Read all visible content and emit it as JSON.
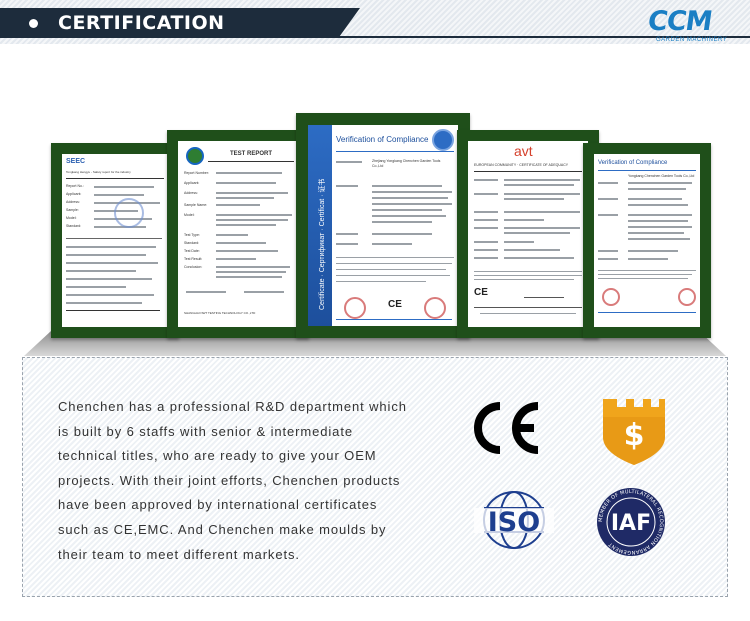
{
  "header": {
    "title": "CERTIFICATION",
    "logo_text": "CCM",
    "logo_sub": "GARDEN MACHINERY"
  },
  "certificates": [
    {
      "name": "certificate-1",
      "brand": "SEEC",
      "top": "Tongkang Hengyu - Safety report for the industry",
      "rows": [
        "Report No.:",
        "Applicant:",
        "Address:",
        "Sample:",
        "Model:",
        "Standard:"
      ]
    },
    {
      "name": "certificate-2",
      "title": "TEST REPORT",
      "rows": [
        "Report Number:",
        "Applicant:",
        "Address:",
        "Sample Name:",
        "Model:",
        "Test Type:",
        "Standard:",
        "Test Date:",
        "Test Result:",
        "Conclusion:"
      ],
      "foot": "SHANGHAI NWT TESTING TECHNOLOGY CO.,LTD"
    },
    {
      "name": "certificate-3",
      "title": "Verification of Compliance",
      "side": "Certificate · Сертификат · Certificat · 证书",
      "holder": "Zhejiang Yongkang Chenchen Garden Tools Co.,Ltd",
      "ce": "CE"
    },
    {
      "name": "certificate-4",
      "brand": "avt",
      "heading": "EUROPEAN COMMUNITY · CERTIFICATE OF ADEQUACY",
      "ce": "CE"
    },
    {
      "name": "certificate-5",
      "title": "Verification of Compliance",
      "holder": "Yongkang Chenchen Garden Tools Co.,Ltd"
    }
  ],
  "description": "Chenchen has a professional R&D department which is built by 6 staffs with senior & intermediate technical titles, who are ready to give your OEM projects. With their joint efforts, Chenchen products have been approved by international certificates such as CE,EMC. And Chenchen make moulds by their team to meet different markets.",
  "badges": {
    "ce": "CE",
    "iso": "ISO",
    "iaf": "IAF",
    "iaf_ring": "MEMBER OF MULTILATERAL RECOGNITION ARRANGEMENT",
    "money_symbol": "$"
  },
  "colors": {
    "header_band": "#1d2c3c",
    "logo_blue": "#1b7fc4",
    "frame_green": "#1f4f1a",
    "iso_blue": "#1e3f8f",
    "iaf_navy": "#1f2a66",
    "badge_gold": "#f0a51c"
  }
}
